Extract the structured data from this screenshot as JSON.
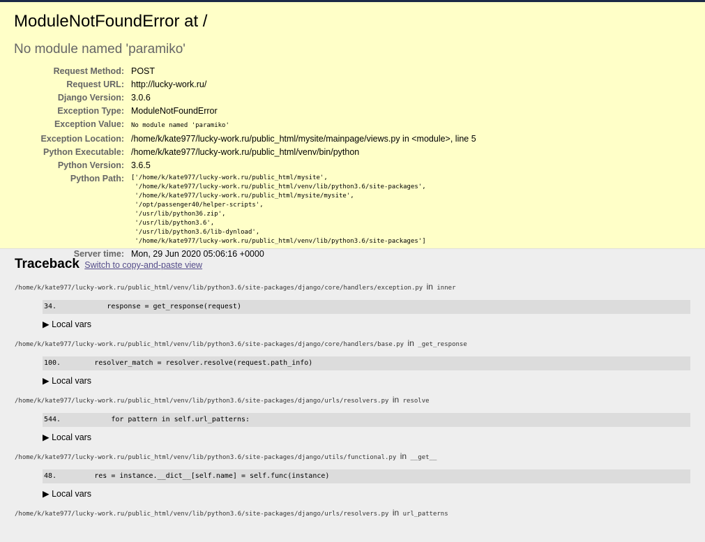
{
  "summary": {
    "title": "ModuleNotFoundError at /",
    "subtitle": "No module named 'paramiko'",
    "rows": [
      {
        "label": "Request Method:",
        "value": "POST"
      },
      {
        "label": "Request URL:",
        "value": "http://lucky-work.ru/"
      },
      {
        "label": "Django Version:",
        "value": "3.0.6"
      },
      {
        "label": "Exception Type:",
        "value": "ModuleNotFoundError"
      },
      {
        "label": "Exception Value:",
        "value": "No module named 'paramiko'"
      },
      {
        "label": "Exception Location:",
        "value": "/home/k/kate977/lucky-work.ru/public_html/mysite/mainpage/views.py in <module>, line 5"
      },
      {
        "label": "Python Executable:",
        "value": "/home/k/kate977/lucky-work.ru/public_html/venv/bin/python"
      },
      {
        "label": "Python Version:",
        "value": "3.6.5"
      },
      {
        "label": "Python Path:",
        "value": "['/home/k/kate977/lucky-work.ru/public_html/mysite',\n '/home/k/kate977/lucky-work.ru/public_html/venv/lib/python3.6/site-packages',\n '/home/k/kate977/lucky-work.ru/public_html/mysite/mysite',\n '/opt/passenger40/helper-scripts',\n '/usr/lib/python36.zip',\n '/usr/lib/python3.6',\n '/usr/lib/python3.6/lib-dynload',\n '/home/k/kate977/lucky-work.ru/public_html/venv/lib/python3.6/site-packages']"
      },
      {
        "label": "Server time:",
        "value": "Mon, 29 Jun 2020 05:06:16 +0000"
      }
    ]
  },
  "traceback": {
    "heading": "Traceback",
    "switch_link": "Switch to copy-and-paste view",
    "in_word": "in",
    "local_vars_label": "▶ Local vars",
    "frames": [
      {
        "file": "/home/k/kate977/lucky-work.ru/public_html/venv/lib/python3.6/site-packages/django/core/handlers/exception.py",
        "func": "inner",
        "line": "34.            response = get_response(request)"
      },
      {
        "file": "/home/k/kate977/lucky-work.ru/public_html/venv/lib/python3.6/site-packages/django/core/handlers/base.py",
        "func": "_get_response",
        "line": "100.        resolver_match = resolver.resolve(request.path_info)"
      },
      {
        "file": "/home/k/kate977/lucky-work.ru/public_html/venv/lib/python3.6/site-packages/django/urls/resolvers.py",
        "func": "resolve",
        "line": "544.            for pattern in self.url_patterns:"
      },
      {
        "file": "/home/k/kate977/lucky-work.ru/public_html/venv/lib/python3.6/site-packages/django/utils/functional.py",
        "func": "__get__",
        "line": "48.         res = instance.__dict__[self.name] = self.func(instance)"
      },
      {
        "file": "/home/k/kate977/lucky-work.ru/public_html/venv/lib/python3.6/site-packages/django/urls/resolvers.py",
        "func": "url_patterns",
        "line": ""
      }
    ]
  }
}
